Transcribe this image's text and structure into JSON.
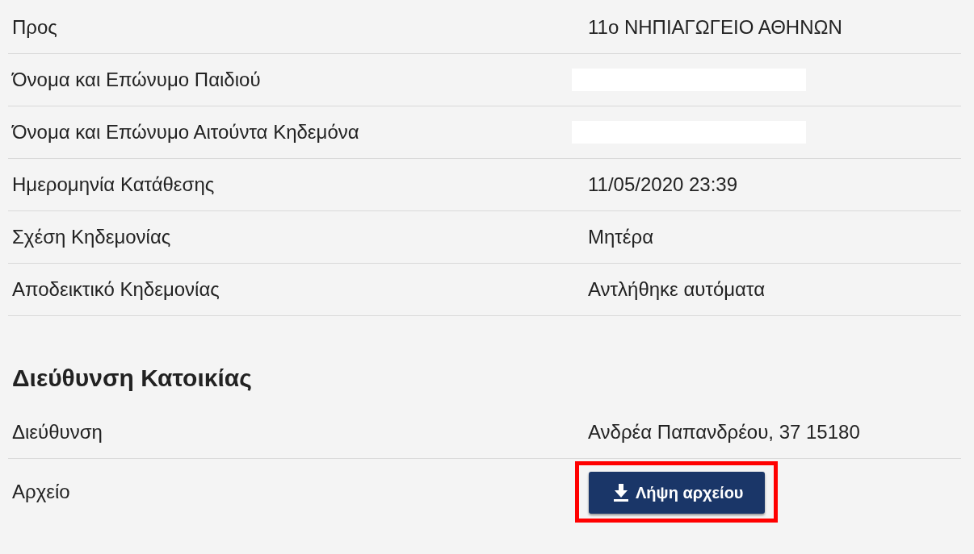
{
  "details": [
    {
      "label": "Προς",
      "value": "11ο ΝΗΠΙΑΓΩΓΕΙΟ ΑΘΗΝΩΝ"
    },
    {
      "label": "Όνομα και Επώνυμο Παιδιού",
      "redacted": true
    },
    {
      "label": "Όνομα και Επώνυμο Αιτούντα Κηδεμόνα",
      "redacted": true
    },
    {
      "label": "Ημερομηνία Κατάθεσης",
      "value": "11/05/2020 23:39"
    },
    {
      "label": "Σχέση Κηδεμονίας",
      "value": "Μητέρα"
    },
    {
      "label": "Αποδεικτικό Κηδεμονίας",
      "value": "Αντλήθηκε αυτόματα"
    }
  ],
  "address_section": {
    "heading": "Διεύθυνση Κατοικίας",
    "rows": [
      {
        "kind": "text",
        "label": "Διεύθυνση",
        "value": "Ανδρέα Παπανδρέου, 37 15180"
      },
      {
        "kind": "download",
        "label": "Αρχείο",
        "button": "Λήψη αρχείου",
        "highlighted": true
      }
    ]
  }
}
